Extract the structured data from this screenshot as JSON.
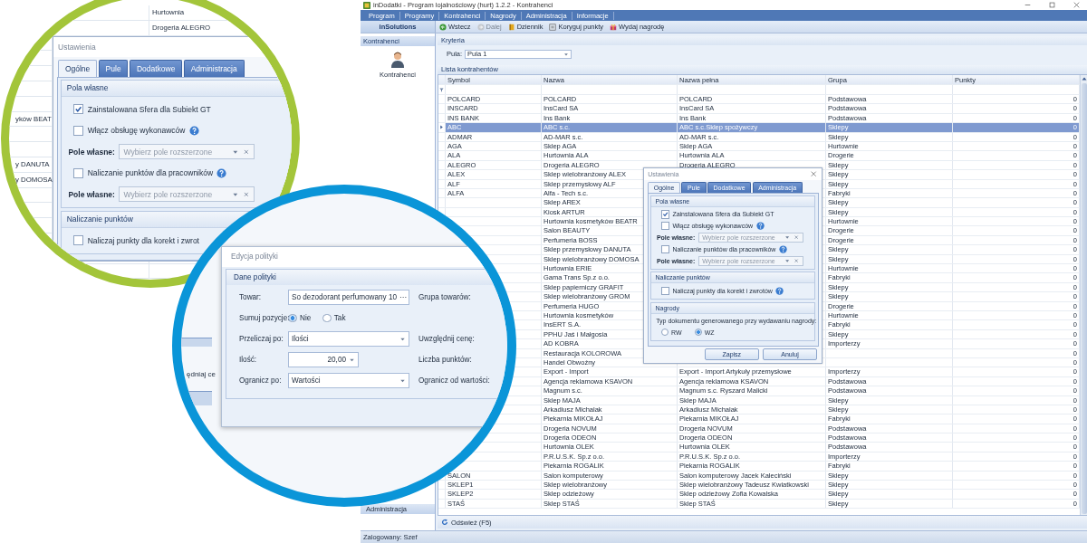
{
  "window": {
    "title": "inDodatki - Program lojalnościowy (hurt) 1.2.2 - Kontrahenci",
    "menu": [
      "Program",
      "Programy",
      "Kontrahenci",
      "Nagrody",
      "Administracja",
      "Informacje"
    ],
    "brand": "inSolutions",
    "toolbar": [
      {
        "label": "Wstecz",
        "disabled": false
      },
      {
        "label": "Dalej",
        "disabled": true
      },
      {
        "label": "Dziennik",
        "disabled": false
      },
      {
        "label": "Koryguj punkty",
        "disabled": false
      },
      {
        "label": "Wydaj nagrodę",
        "disabled": false
      }
    ]
  },
  "sidebar": {
    "header": "Kontrahenci",
    "items": [
      "Kontrahenci"
    ],
    "footer_items": [
      "Administracja"
    ]
  },
  "criteria": {
    "title": "Kryteria",
    "pool_label": "Pula:",
    "pool_value": "Pula 1"
  },
  "table": {
    "title": "Lista kontrahentów",
    "columns": [
      "Symbol",
      "Nazwa",
      "Nazwa pełna",
      "Grupa",
      "Punkty"
    ],
    "rows": [
      {
        "symbol": "POLCARD",
        "name": "POLCARD",
        "full_name": "POLCARD",
        "group": "Podstawowa",
        "points": "0",
        "selected": false
      },
      {
        "symbol": "INSCARD",
        "name": "InsCard SA",
        "full_name": "InsCard SA",
        "group": "Podstawowa",
        "points": "0",
        "selected": false
      },
      {
        "symbol": "INS BANK",
        "name": "Ins Bank",
        "full_name": "Ins Bank",
        "group": "Podstawowa",
        "points": "0",
        "selected": false
      },
      {
        "symbol": "ABC",
        "name": "ABC s.c.",
        "full_name": "ABC s.c.Sklep spożywczy",
        "group": "Sklepy",
        "points": "0",
        "selected": true
      },
      {
        "symbol": "ADMAR",
        "name": "AD-MAR s.c.",
        "full_name": "AD-MAR s.c.",
        "group": "Sklepy",
        "points": "0",
        "selected": false
      },
      {
        "symbol": "AGA",
        "name": "Sklep AGA",
        "full_name": "Sklep AGA",
        "group": "Hurtownie",
        "points": "0",
        "selected": false
      },
      {
        "symbol": "ALA",
        "name": "Hurtownia ALA",
        "full_name": "Hurtownia ALA",
        "group": "Drogerie",
        "points": "0",
        "selected": false
      },
      {
        "symbol": "ALEGRO",
        "name": "Drogeria ALEGRO",
        "full_name": "Drogeria ALEGRO",
        "group": "Sklepy",
        "points": "0",
        "selected": false
      },
      {
        "symbol": "ALEX",
        "name": "Sklep wielobranżowy  ALEX",
        "group": "Sklepy",
        "points": "0",
        "selected": false
      },
      {
        "symbol": "ALF",
        "name": "Sklep przemysłowy ALF",
        "group": "Sklepy",
        "points": "0",
        "selected": false
      },
      {
        "symbol": "ALFA",
        "name": "Alfa - Tech s.c.",
        "group": "Fabryki",
        "points": "0",
        "selected": false
      },
      {
        "name": "Sklep AREX",
        "group": "Sklepy",
        "points": "0",
        "selected": false
      },
      {
        "name": "Kiosk ARTUR",
        "group": "Sklepy",
        "points": "0",
        "selected": false
      },
      {
        "name": "Hurtownia kosmetyków BEATR",
        "group": "Hurtownie",
        "points": "0",
        "selected": false
      },
      {
        "name": "Salon BEAUTY",
        "group": "Drogerie",
        "points": "0",
        "selected": false
      },
      {
        "name": "Perfumeria BOSS",
        "group": "Drogerie",
        "points": "0",
        "selected": false
      },
      {
        "name": "Sklep przemysłowy DANUTA",
        "group": "Sklepy",
        "points": "0",
        "selected": false
      },
      {
        "name": "Sklep wielobranżowy DOMOSA",
        "group": "Sklepy",
        "points": "0",
        "selected": false
      },
      {
        "name": "Hurtownia ERIE",
        "group": "Hurtownie",
        "points": "0",
        "selected": false
      },
      {
        "name": "Gama Trans Sp.z o.o.",
        "group": "Fabryki",
        "points": "0",
        "selected": false
      },
      {
        "name": "Sklep papierniczy GRAFIT",
        "group": "Sklepy",
        "points": "0",
        "selected": false
      },
      {
        "name": "Sklep wielobranżowy GROM",
        "group": "Sklepy",
        "points": "0",
        "selected": false
      },
      {
        "name": "Perfumeria HUGO",
        "group": "Drogerie",
        "points": "0",
        "selected": false
      },
      {
        "name": "Hurtownia kosmetyków",
        "group": "Hurtownie",
        "points": "0",
        "selected": false
      },
      {
        "name": "InsERT S.A.",
        "group": "Fabryki",
        "points": "0",
        "selected": false
      },
      {
        "name": "PPHU Jaś i Małgosia",
        "group": "Sklepy",
        "points": "0",
        "selected": false
      },
      {
        "name": "AD KOBRA",
        "group": "Importerzy",
        "points": "0",
        "selected": false
      },
      {
        "name": "Restauracja KOLOROWA",
        "points": "0",
        "selected": false
      },
      {
        "name": "Handel Obwoźny",
        "points": "0",
        "selected": false
      },
      {
        "name": "Export - Import",
        "full_name": "Export - Import Artykuły przemysłowe",
        "group": "Importerzy",
        "points": "0",
        "selected": false
      },
      {
        "name": "Agencja reklamowa KSAVON",
        "full_name": "Agencja reklamowa KSAVON",
        "group": "Podstawowa",
        "points": "0",
        "selected": false
      },
      {
        "name": "Magnum s.c.",
        "full_name": "Magnum s.c. Ryszard Malicki",
        "group": "Podstawowa",
        "points": "0",
        "selected": false
      },
      {
        "name": "Sklep MAJA",
        "full_name": "Sklep MAJA",
        "group": "Sklepy",
        "points": "0",
        "selected": false
      },
      {
        "name": "Arkadiusz Michalak",
        "full_name": "Arkadiusz Michalak",
        "group": "Sklepy",
        "points": "0",
        "selected": false
      },
      {
        "name": "Piekarnia MIKOŁAJ",
        "full_name": "Piekarnia MIKOŁAJ",
        "group": "Fabryki",
        "points": "0",
        "selected": false
      },
      {
        "name": "Drogeria NOVUM",
        "full_name": "Drogeria NOVUM",
        "group": "Podstawowa",
        "points": "0",
        "selected": false
      },
      {
        "name": "Drogeria ODEON",
        "full_name": "Drogeria ODEON",
        "group": "Podstawowa",
        "points": "0",
        "selected": false
      },
      {
        "name": "Hurtownia OLEK",
        "full_name": "Hurtownia OLEK",
        "group": "Podstawowa",
        "points": "0",
        "selected": false
      },
      {
        "name": "P.R.U.S.K. Sp.z o.o.",
        "full_name": "P.R.U.S.K. Sp.z o.o.",
        "group": "Importerzy",
        "points": "0",
        "selected": false
      },
      {
        "name": "Piekarnia ROGALIK",
        "full_name": "Piekarnia ROGALIK",
        "group": "Fabryki",
        "points": "0",
        "selected": false
      },
      {
        "symbol": "SALON",
        "name": "Salon komputerowy",
        "full_name": "Salon komputerowy Jacek Kaleciński",
        "group": "Sklepy",
        "points": "0",
        "selected": false
      },
      {
        "symbol": "SKLEP1",
        "name": "Sklep wielobranżowy",
        "full_name": "Sklep wielobranżowy Tadeusz Kwiatkowski",
        "group": "Sklepy",
        "points": "0",
        "selected": false
      },
      {
        "symbol": "SKLEP2",
        "name": "Sklep odzieżowy",
        "full_name": "Sklep odzieżowy Zofia Kowalska",
        "group": "Sklepy",
        "points": "0",
        "selected": false
      },
      {
        "symbol": "STAŚ",
        "name": "Sklep STAŚ",
        "full_name": "Sklep STAŚ",
        "group": "Sklepy",
        "points": "0",
        "selected": false
      }
    ]
  },
  "refresh_button": "Odśwież (F5)",
  "status_bar": "Zalogowany: Szef",
  "settings_dialog": {
    "title": "Ustawienia",
    "closable": true,
    "tabs": [
      {
        "label": "Ogólne",
        "selected": true
      },
      {
        "label": "Pule",
        "selected": false
      },
      {
        "label": "Dodatkowe",
        "selected": false
      },
      {
        "label": "Administracja",
        "selected": false
      }
    ],
    "groups": [
      {
        "title": "Pola własne",
        "items": [
          {
            "kind": "checkbox",
            "label": "Zainstalowana Sfera dla Subiekt GT",
            "checked": true,
            "help": false
          },
          {
            "kind": "checkbox",
            "label": "Włącz obsługę wykonawców",
            "checked": false,
            "help": true
          },
          {
            "kind": "field",
            "label": "Pole własne:",
            "placeholder": "Wybierz pole rozszerzone"
          },
          {
            "kind": "checkbox",
            "label": "Naliczanie punktów dla pracowników",
            "checked": false,
            "help": true
          },
          {
            "kind": "field",
            "label": "Pole własne:",
            "placeholder": "Wybierz pole rozszerzone"
          }
        ]
      },
      {
        "title": "Naliczanie punktów",
        "items": [
          {
            "kind": "checkbox",
            "label": "Naliczaj punkty dla korekt i zwrotów",
            "checked": false,
            "help": true
          }
        ]
      },
      {
        "title": "Nagrody",
        "items": [
          {
            "kind": "text",
            "label": "Typ dokumentu generowanego przy wydawaniu nagrody:"
          },
          {
            "kind": "radios",
            "options": [
              {
                "label": "RW",
                "selected": false
              },
              {
                "label": "WZ",
                "selected": true
              }
            ]
          }
        ]
      }
    ],
    "buttons": [
      "Zapisz",
      "Anuluj"
    ]
  },
  "settings_zoom": {
    "background_rows": [
      {
        "column_2": "Hurtownia"
      },
      {
        "column_2": "Drogeria ALEGRO"
      },
      {},
      {},
      {},
      {},
      {},
      {
        "column_1": "yków BEAT"
      },
      {},
      {},
      {
        "column_1": "y DANUTA"
      },
      {
        "column_1": "y DOMOSA"
      },
      {},
      {},
      {},
      {},
      {},
      {}
    ],
    "dialog": {
      "title": "Ustawienia",
      "closable": false,
      "tabs": [
        {
          "label": "Ogólne",
          "selected": true
        },
        {
          "label": "Pule",
          "selected": false
        },
        {
          "label": "Dodatkowe",
          "selected": false
        },
        {
          "label": "Administracja",
          "selected": false
        }
      ],
      "groups": [
        {
          "title": "Pola własne",
          "items": [
            {
              "kind": "checkbox",
              "label": "Zainstalowana Sfera dla Subiekt GT",
              "checked": true,
              "help": false
            },
            {
              "kind": "checkbox",
              "label": "Włącz obsługę wykonawców",
              "checked": false,
              "help": true
            },
            {
              "kind": "field",
              "label": "Pole własne:",
              "placeholder": "Wybierz pole rozszerzone"
            },
            {
              "kind": "checkbox",
              "label": "Naliczanie punktów dla pracowników",
              "checked": false,
              "help": true
            },
            {
              "kind": "field",
              "label": "Pole własne:",
              "placeholder": "Wybierz pole rozszerzone"
            }
          ]
        },
        {
          "title": "Naliczanie punktów",
          "items": [
            {
              "kind": "checkbox",
              "label": "Naliczaj punkty dla korekt i zwrot",
              "checked": false,
              "help": false
            }
          ]
        }
      ]
    }
  },
  "policy_zoom": {
    "fragment": "ędniaj ce",
    "dialog": {
      "title": "Edycja polityki",
      "group": "Dane polityki",
      "rows": [
        {
          "kind": "picker",
          "label": "Towar:",
          "value": "So dezodorant perfumowany 10",
          "button": "···",
          "side_label": "Grupa towarów:"
        },
        {
          "kind": "radios",
          "label": "Sumuj pozycje:",
          "options": [
            {
              "label": "Nie",
              "selected": true
            },
            {
              "label": "Tak",
              "selected": false
            }
          ]
        },
        {
          "kind": "dropdown",
          "label": "Przeliczaj po:",
          "value": "Ilości",
          "side_label": "Uwzględnij cenę:"
        },
        {
          "kind": "spinner",
          "label": "Ilość:",
          "value": "20,00",
          "side_label": "Liczba punktów:"
        },
        {
          "kind": "dropdown",
          "label": "Ogranicz po:",
          "value": "Wartości",
          "side_label": "Ogranicz od wartości:"
        }
      ]
    }
  }
}
